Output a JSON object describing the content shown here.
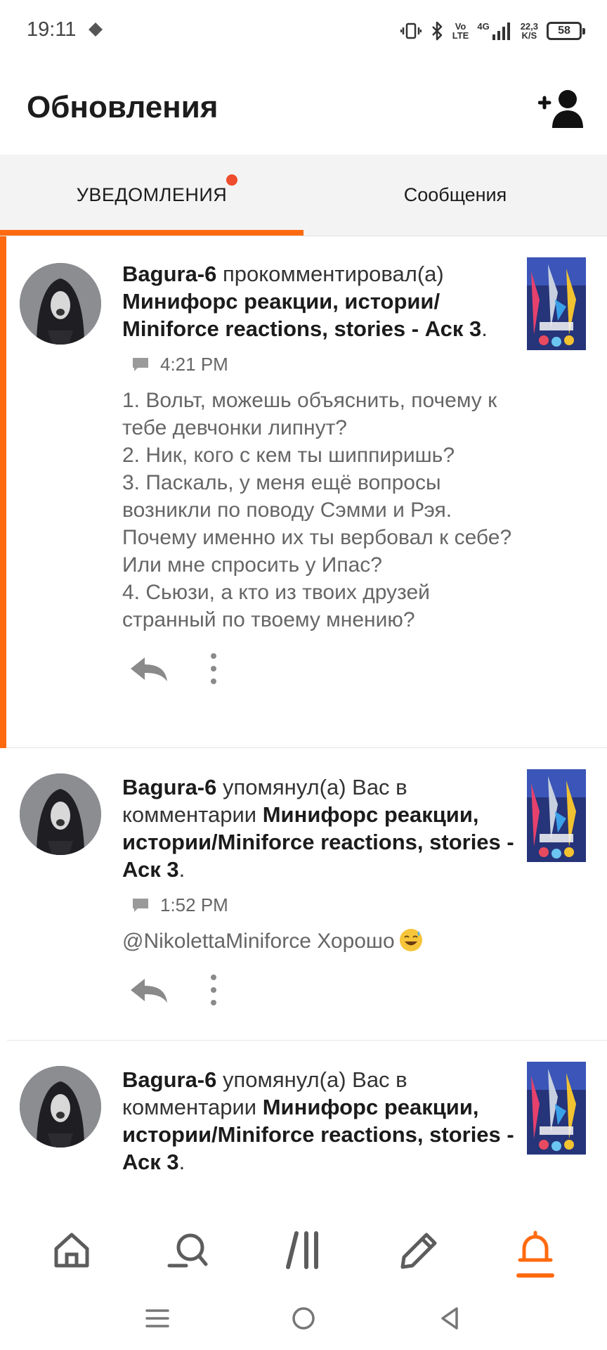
{
  "status_bar": {
    "time": "19:11",
    "volte_top": "Vo",
    "volte_bottom": "LTE",
    "network": "4G",
    "speed_top": "22,3",
    "speed_bottom": "K/S",
    "battery": "58"
  },
  "header": {
    "title": "Обновления",
    "add_icon": "add-person-icon"
  },
  "tabs": [
    {
      "label": "УВЕДОМЛЕНИЯ",
      "active": true,
      "has_badge": true
    },
    {
      "label": "Сообщения",
      "active": false,
      "has_badge": false
    }
  ],
  "notifications": [
    {
      "user": "Bagura-6",
      "action": " прокомментировал(а) ",
      "target": "Минифорс реакции, истории/ Miniforce reactions, stories - Аск 3",
      "end": ".",
      "time": "4:21 PM",
      "body": "1. Вольт, можешь объяснить, почему к тебе девчонки липнут?\n2. Ник, кого с кем ты шиппиришь?\n3. Паскаль, у меня ещё вопросы возникли по поводу Сэмми и Рэя. Почему именно их ты вербовал к себе? Или мне спросить у Ипас?\n4. Сьюзи, а кто из твоих  друзей странный по твоему мнению?",
      "unread": true
    },
    {
      "user": "Bagura-6",
      "action": " упомянул(а) Вас в комментарии ",
      "target": "Минифорс реакции, истории/Miniforce reactions, stories - Аск 3",
      "end": ".",
      "time": "1:52 PM",
      "body": "@NikolettaMiniforce Хорошо",
      "unread": false
    },
    {
      "user": "Bagura-6",
      "action": " упомянул(а) Вас в комментарии ",
      "target": "Минифорс реакции, истории/Miniforce reactions, stories - Аск 3",
      "end": ".",
      "unread": false
    }
  ],
  "bottom_nav": [
    {
      "icon": "home-icon",
      "active": false
    },
    {
      "icon": "search-icon",
      "active": false
    },
    {
      "icon": "library-icon",
      "active": false
    },
    {
      "icon": "write-icon",
      "active": false
    },
    {
      "icon": "bell-icon",
      "active": true
    }
  ],
  "colors": {
    "accent": "#ff6a10",
    "badge": "#ee4d2d",
    "tab_bg": "#f3f3f3"
  }
}
